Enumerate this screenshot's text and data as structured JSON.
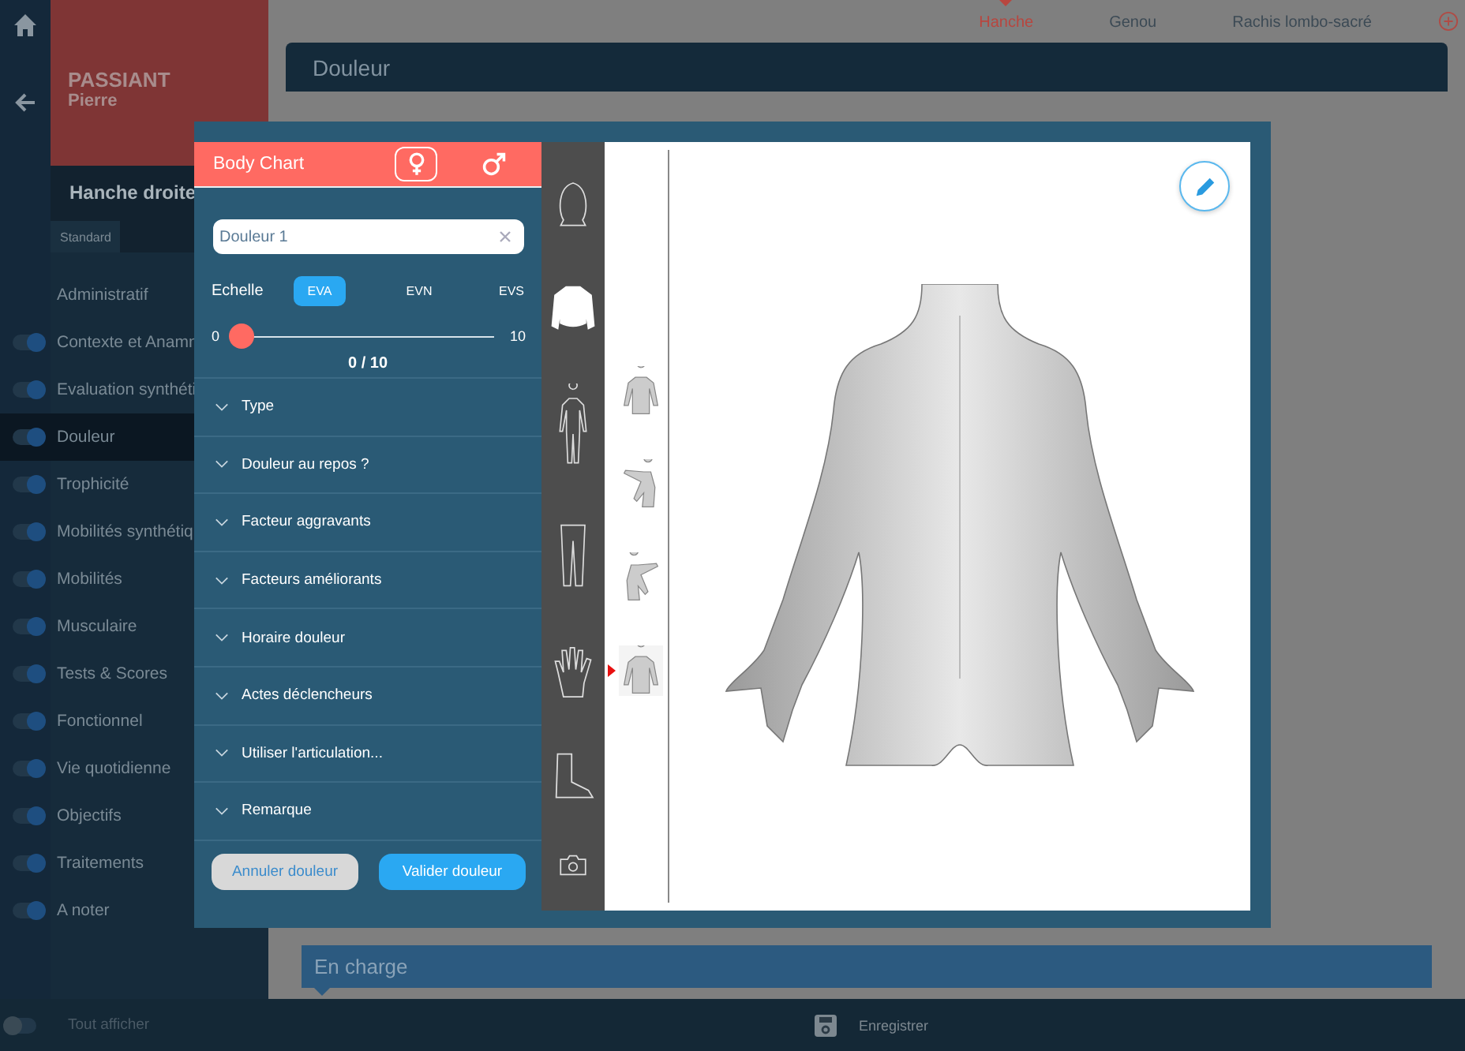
{
  "patient": {
    "last_name": "PASSIANT",
    "first_name": "Pierre"
  },
  "region": "Hanche droite",
  "sidebar_tabs": [
    {
      "label": "Standard",
      "selected": true
    }
  ],
  "sidebar": {
    "items": [
      {
        "label": "Administratif",
        "kind": "plain",
        "selected": false
      },
      {
        "label": "Contexte et Anamn",
        "kind": "toggle",
        "on": true,
        "selected": false
      },
      {
        "label": "Evaluation synthéti",
        "kind": "toggle",
        "on": true,
        "selected": false
      },
      {
        "label": "Douleur",
        "kind": "toggle",
        "on": true,
        "selected": true
      },
      {
        "label": "Trophicité",
        "kind": "toggle",
        "on": true,
        "selected": false
      },
      {
        "label": "Mobilités synthétiq",
        "kind": "toggle",
        "on": true,
        "selected": false
      },
      {
        "label": "Mobilités",
        "kind": "toggle",
        "on": true,
        "selected": false
      },
      {
        "label": "Musculaire",
        "kind": "toggle",
        "on": true,
        "selected": false
      },
      {
        "label": "Tests & Scores",
        "kind": "toggle",
        "on": true,
        "selected": false
      },
      {
        "label": "Fonctionnel",
        "kind": "toggle",
        "on": true,
        "selected": false
      },
      {
        "label": "Vie quotidienne",
        "kind": "toggle",
        "on": true,
        "selected": false
      },
      {
        "label": "Objectifs",
        "kind": "toggle",
        "on": true,
        "selected": false
      },
      {
        "label": "Traitements",
        "kind": "toggle",
        "on": true,
        "selected": false
      },
      {
        "label": "A noter",
        "kind": "toggle",
        "on": true,
        "selected": false
      }
    ]
  },
  "top_tabs": [
    {
      "label": "Hanche",
      "selected": true
    },
    {
      "label": "Genou",
      "selected": false
    },
    {
      "label": "Rachis lombo-sacré",
      "selected": false
    }
  ],
  "section_title": "Douleur",
  "next_section": "En charge",
  "footer": {
    "show_all": {
      "label": "Tout afficher",
      "on": false
    },
    "save": "Enregistrer"
  },
  "modal": {
    "title": "Body Chart",
    "sex": [
      {
        "kind": "female",
        "selected": true
      },
      {
        "kind": "male",
        "selected": false
      }
    ],
    "name_field": {
      "value": "Douleur 1"
    },
    "scale": {
      "label": "Echelle",
      "options": [
        {
          "label": "EVA",
          "selected": true
        },
        {
          "label": "EVN",
          "selected": false
        },
        {
          "label": "EVS",
          "selected": false
        }
      ]
    },
    "slider": {
      "min": "0",
      "max": "10",
      "level": 0,
      "reading": "0 / 10"
    },
    "sections": [
      {
        "label": "Type",
        "expanded": false
      },
      {
        "label": "Douleur au repos ?",
        "expanded": false
      },
      {
        "label": "Facteur aggravants",
        "expanded": false
      },
      {
        "label": "Facteurs améliorants",
        "expanded": false
      },
      {
        "label": "Horaire douleur",
        "expanded": false
      },
      {
        "label": "Actes déclencheurs",
        "expanded": false
      },
      {
        "label": "Utiliser l'articulation...",
        "expanded": false
      },
      {
        "label": "Remarque",
        "expanded": false
      }
    ],
    "buttons": [
      {
        "label": "Annuler douleur",
        "kind": "secondary"
      },
      {
        "label": "Valider douleur",
        "kind": "primary"
      }
    ],
    "body_parts": [
      {
        "kind": "head",
        "selected": false
      },
      {
        "kind": "torso",
        "selected": true
      },
      {
        "kind": "body",
        "selected": false
      },
      {
        "kind": "legs",
        "selected": false
      },
      {
        "kind": "hand",
        "selected": false
      },
      {
        "kind": "foot",
        "selected": false
      },
      {
        "kind": "camera",
        "selected": false
      }
    ],
    "views": [
      {
        "kind": "front",
        "selected": false
      },
      {
        "kind": "left",
        "selected": false
      },
      {
        "kind": "right",
        "selected": false
      },
      {
        "kind": "back",
        "selected": true
      }
    ]
  }
}
